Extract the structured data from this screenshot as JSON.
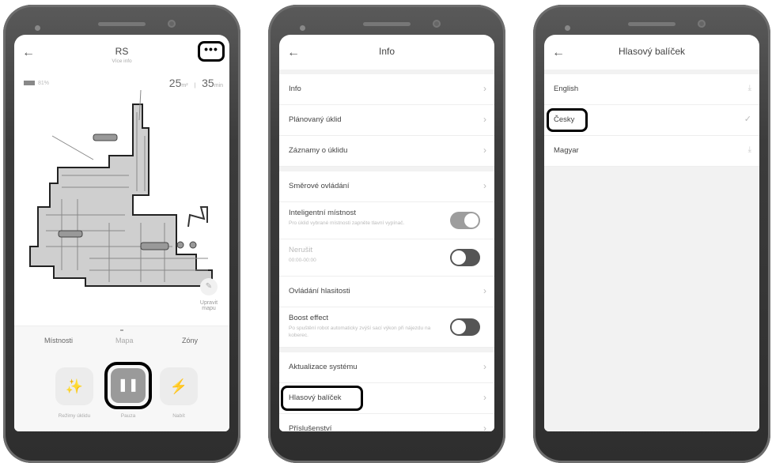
{
  "phone1": {
    "title": "RS",
    "subtitle": "Více info",
    "more_label": "•••",
    "battery": "81%",
    "area_value": "25",
    "area_unit": "m²",
    "sep": "|",
    "time_value": "35",
    "time_unit": "min",
    "edit_map_label": "Upravit mapu",
    "tabs": [
      "Místnosti",
      "Mapa",
      "Zóny"
    ],
    "controls": [
      {
        "label": "Režimy úklidu",
        "icon": "broom-icon"
      },
      {
        "label": "Pauza",
        "icon": "pause-icon"
      },
      {
        "label": "Nabít",
        "icon": "charge-icon"
      }
    ]
  },
  "phone2": {
    "title": "Info",
    "rows": [
      {
        "label": "Info"
      },
      {
        "label": "Plánovaný úklid"
      },
      {
        "label": "Záznamy o úklidu"
      },
      {
        "label": "Směrové ovládání"
      },
      {
        "label": "Inteligentní místnost",
        "desc": "Pro úklid vybrané místnosti zapněte tlavní vypínač.",
        "toggle": "on"
      },
      {
        "label": "Nerušit",
        "desc": "00:00-00:00",
        "toggle": "off"
      },
      {
        "label": "Ovládání hlasitosti"
      },
      {
        "label": "Boost effect",
        "desc": "Po spuštění robot automaticky zvýší sací výkon při nájezdu na koberec.",
        "toggle": "off"
      },
      {
        "label": "Aktualizace systému"
      },
      {
        "label": "Hlasový balíček"
      },
      {
        "label": "Příslušenství"
      }
    ]
  },
  "phone3": {
    "title": "Hlasový balíček",
    "languages": [
      {
        "label": "English",
        "state": "download"
      },
      {
        "label": "Česky",
        "state": "selected"
      },
      {
        "label": "Magyar",
        "state": "download"
      }
    ]
  },
  "colors": {
    "highlight": "#000000",
    "screen_bg": "#ffffff",
    "list_bg": "#f2f2f2"
  }
}
